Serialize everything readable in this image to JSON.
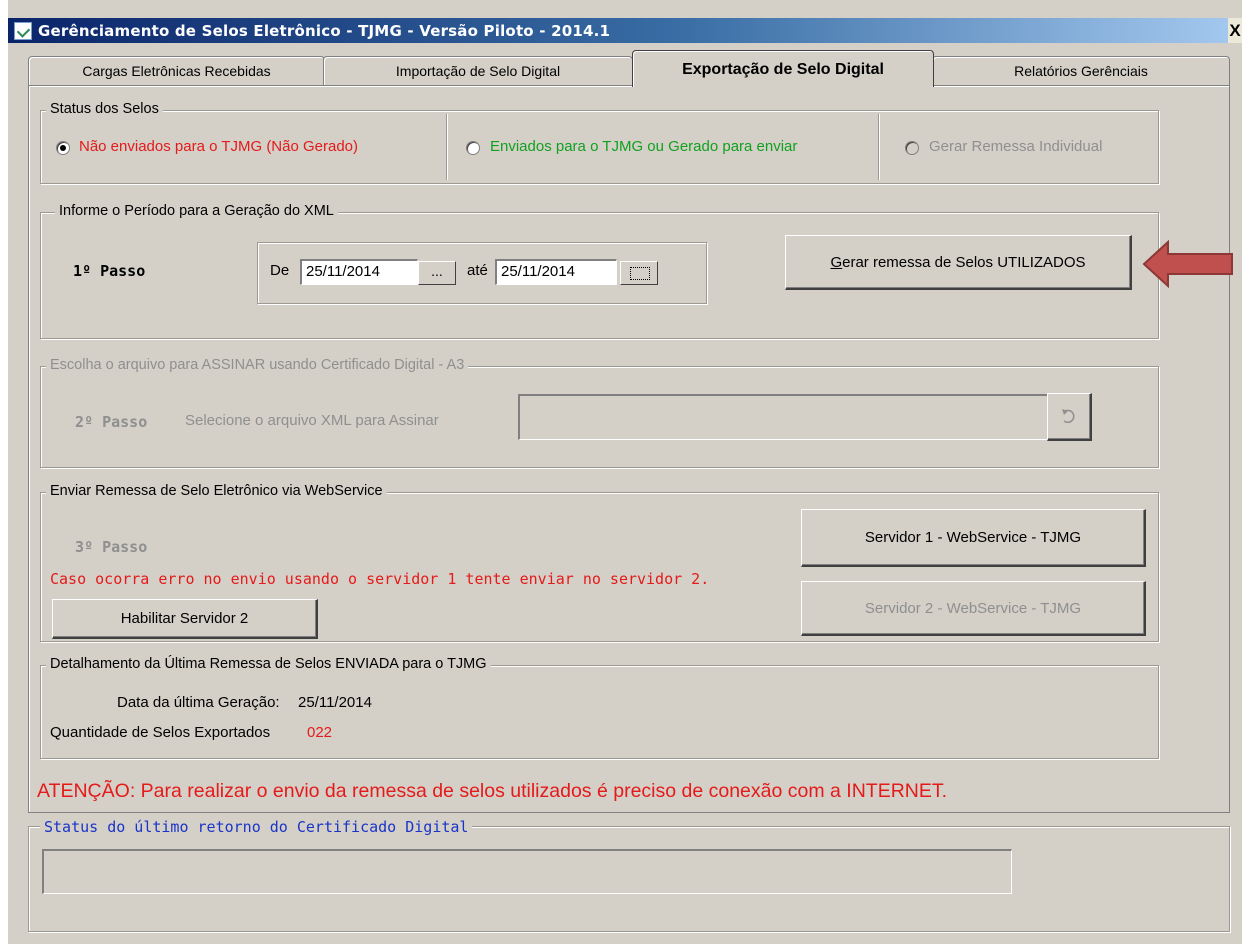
{
  "window": {
    "title": "Gerênciamento de Selos Eletrônico - TJMG  - Versão Piloto - 2014.1",
    "close_glyph": "X",
    "icon": "app-icon"
  },
  "tabs": [
    {
      "label": "Cargas Eletrônicas Recebidas",
      "active": false
    },
    {
      "label": "Importação de Selo Digital",
      "active": false
    },
    {
      "label": "Exportação de Selo Digital",
      "active": true
    },
    {
      "label": "Relatórios Gerênciais",
      "active": false
    }
  ],
  "status_selos": {
    "legend": "Status dos Selos",
    "options": [
      {
        "label": "Não enviados para o TJMG (Não Gerado)",
        "checked": true,
        "color": "#e51a1a"
      },
      {
        "label": "Enviados para o TJMG  ou Gerado para enviar",
        "checked": false,
        "color": "#11a11f"
      },
      {
        "label": "Gerar Remessa Individual",
        "checked": false,
        "disabled": true
      }
    ]
  },
  "periodo": {
    "legend": "Informe o Período para a Geração do XML",
    "step": "1º Passo",
    "de_label": "De",
    "de_value": "25/11/2014",
    "de_button": "...",
    "ate_label": "até",
    "ate_value": "25/11/2014",
    "button_mnemonic": "G",
    "button_rest": "erar remessa de Selos UTILIZADOS",
    "arrow_color": "#c0504d"
  },
  "assinar": {
    "legend": "Escolha o arquivo para ASSINAR usando Certificado Digital - A3",
    "step": "2º Passo",
    "label": "Selecione o arquivo XML para Assinar",
    "value": "",
    "browse_icon": "refresh-icon"
  },
  "webservice": {
    "legend": "Enviar Remessa de Selo Eletrônico via WebService",
    "step": "3º Passo",
    "warning": "Caso ocorra erro no envio usando o servidor 1 tente enviar no servidor 2.",
    "enable_button": "Habilitar Servidor 2",
    "server1_button": "Servidor 1 - WebService - TJMG",
    "server2_button": "Servidor 2  - WebService - TJMG"
  },
  "detalhamento": {
    "legend": "Detalhamento da Última  Remessa de Selos  ENVIADA para o  TJMG",
    "data_label": "Data da última  Geração:",
    "data_value": "25/11/2014",
    "qtd_label": "Quantidade de Selos Exportados",
    "qtd_value": "022"
  },
  "atencao": "ATENÇÃO: Para realizar o envio da remessa de selos utilizados é preciso de conexão com a INTERNET.",
  "certificado": {
    "legend": "Status do último retorno do Certificado Digital",
    "value": ""
  }
}
